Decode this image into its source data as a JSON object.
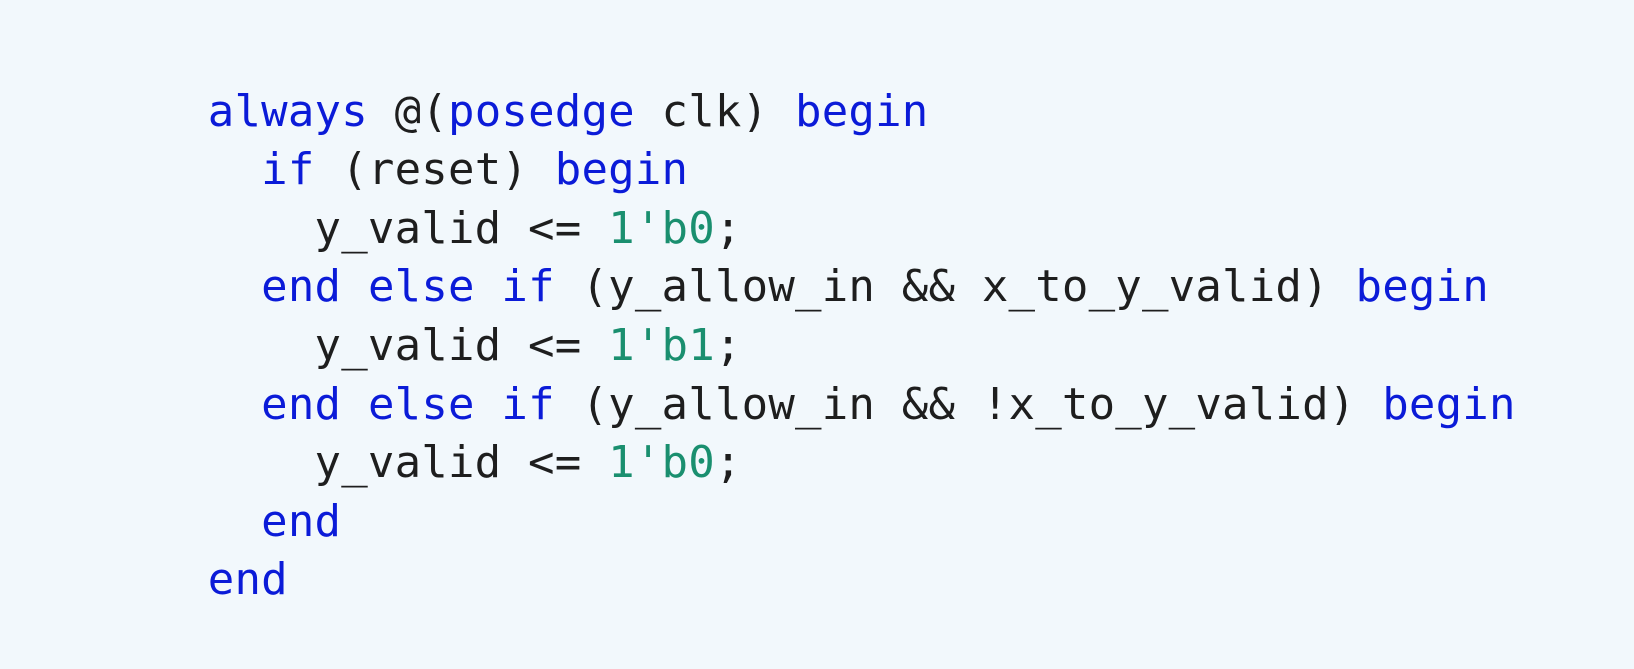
{
  "code": {
    "lines": [
      [
        {
          "t": "always",
          "k": "kw"
        },
        {
          "t": " @(",
          "k": "plain"
        },
        {
          "t": "posedge",
          "k": "kw"
        },
        {
          "t": " clk) ",
          "k": "plain"
        },
        {
          "t": "begin",
          "k": "kw"
        }
      ],
      [
        {
          "t": "  ",
          "k": "plain"
        },
        {
          "t": "if",
          "k": "kw"
        },
        {
          "t": " (reset) ",
          "k": "plain"
        },
        {
          "t": "begin",
          "k": "kw"
        }
      ],
      [
        {
          "t": "    y_valid <= ",
          "k": "plain"
        },
        {
          "t": "1'b0",
          "k": "num"
        },
        {
          "t": ";",
          "k": "plain"
        }
      ],
      [
        {
          "t": "  ",
          "k": "plain"
        },
        {
          "t": "end",
          "k": "kw"
        },
        {
          "t": " ",
          "k": "plain"
        },
        {
          "t": "else",
          "k": "kw"
        },
        {
          "t": " ",
          "k": "plain"
        },
        {
          "t": "if",
          "k": "kw"
        },
        {
          "t": " (y_allow_in && x_to_y_valid) ",
          "k": "plain"
        },
        {
          "t": "begin",
          "k": "kw"
        }
      ],
      [
        {
          "t": "    y_valid <= ",
          "k": "plain"
        },
        {
          "t": "1'b1",
          "k": "num"
        },
        {
          "t": ";",
          "k": "plain"
        }
      ],
      [
        {
          "t": "  ",
          "k": "plain"
        },
        {
          "t": "end",
          "k": "kw"
        },
        {
          "t": " ",
          "k": "plain"
        },
        {
          "t": "else",
          "k": "kw"
        },
        {
          "t": " ",
          "k": "plain"
        },
        {
          "t": "if",
          "k": "kw"
        },
        {
          "t": " (y_allow_in && !x_to_y_valid) ",
          "k": "plain"
        },
        {
          "t": "begin",
          "k": "kw"
        }
      ],
      [
        {
          "t": "    y_valid <= ",
          "k": "plain"
        },
        {
          "t": "1'b0",
          "k": "num"
        },
        {
          "t": ";",
          "k": "plain"
        }
      ],
      [
        {
          "t": "  ",
          "k": "plain"
        },
        {
          "t": "end",
          "k": "kw"
        }
      ],
      [
        {
          "t": "end",
          "k": "kw"
        }
      ]
    ]
  },
  "colors": {
    "background": "#f2f8fc",
    "keyword": "#0b1bd8",
    "number": "#1a8f6f",
    "text": "#1e1e1e"
  }
}
